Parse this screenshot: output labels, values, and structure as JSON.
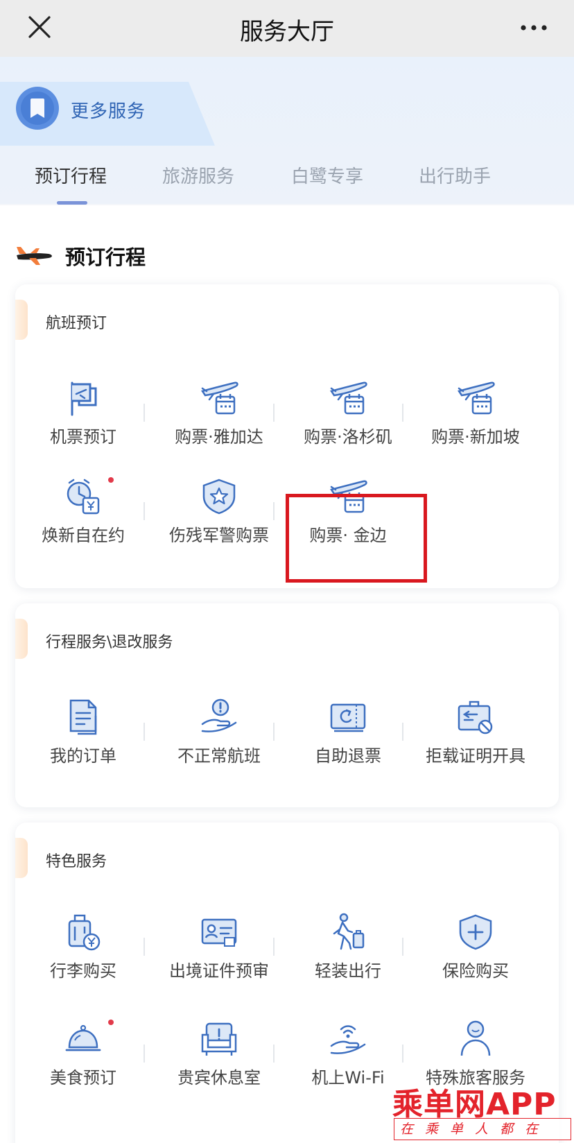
{
  "topbar": {
    "title": "服务大厅"
  },
  "hero": {
    "more_services_label": "更多服务"
  },
  "tabs": [
    {
      "label": "预订行程",
      "active": true
    },
    {
      "label": "旅游服务",
      "active": false
    },
    {
      "label": "白鹭专享",
      "active": false
    },
    {
      "label": "出行助手",
      "active": false
    }
  ],
  "section": {
    "title": "预订行程"
  },
  "cards": {
    "flight": {
      "title": "航班预订",
      "items": [
        {
          "label": "机票预订",
          "icon": "flag-plane-icon"
        },
        {
          "label": "购票·雅加达",
          "icon": "plane-calendar-icon"
        },
        {
          "label": "购票·洛杉矶",
          "icon": "plane-calendar-icon"
        },
        {
          "label": "购票·新加坡",
          "icon": "plane-calendar-icon"
        },
        {
          "label": "焕新自在约",
          "icon": "clock-yuan-icon"
        },
        {
          "label": "伤残军警购票",
          "icon": "shield-star-icon"
        },
        {
          "label": "购票· 金边",
          "icon": "plane-calendar-icon"
        }
      ]
    },
    "trip": {
      "title": "行程服务\\退改服务",
      "items": [
        {
          "label": "我的订单",
          "icon": "document-icon"
        },
        {
          "label": "不正常航班",
          "icon": "hand-alert-icon"
        },
        {
          "label": "自助退票",
          "icon": "ticket-refund-icon"
        },
        {
          "label": "拒载证明开具",
          "icon": "certificate-ban-icon"
        }
      ]
    },
    "special": {
      "title": "特色服务",
      "items": [
        {
          "label": "行李购买",
          "icon": "luggage-yuan-icon"
        },
        {
          "label": "出境证件预审",
          "icon": "id-card-icon"
        },
        {
          "label": "轻装出行",
          "icon": "walker-luggage-icon"
        },
        {
          "label": "保险购买",
          "icon": "shield-plus-icon"
        },
        {
          "label": "美食预订",
          "icon": "cloche-icon"
        },
        {
          "label": "贵宾休息室",
          "icon": "armchair-icon"
        },
        {
          "label": "机上Wi-Fi",
          "icon": "hand-wifi-icon"
        },
        {
          "label": "特殊旅客服务",
          "icon": "person-icon"
        }
      ]
    }
  },
  "watermark": {
    "main": "乘单网APP",
    "sub": "在乘单人都在用"
  },
  "colors": {
    "accent_blue": "#3d6fc0",
    "highlight_red": "#d9181f",
    "badge_dot": "#e23a4a"
  }
}
